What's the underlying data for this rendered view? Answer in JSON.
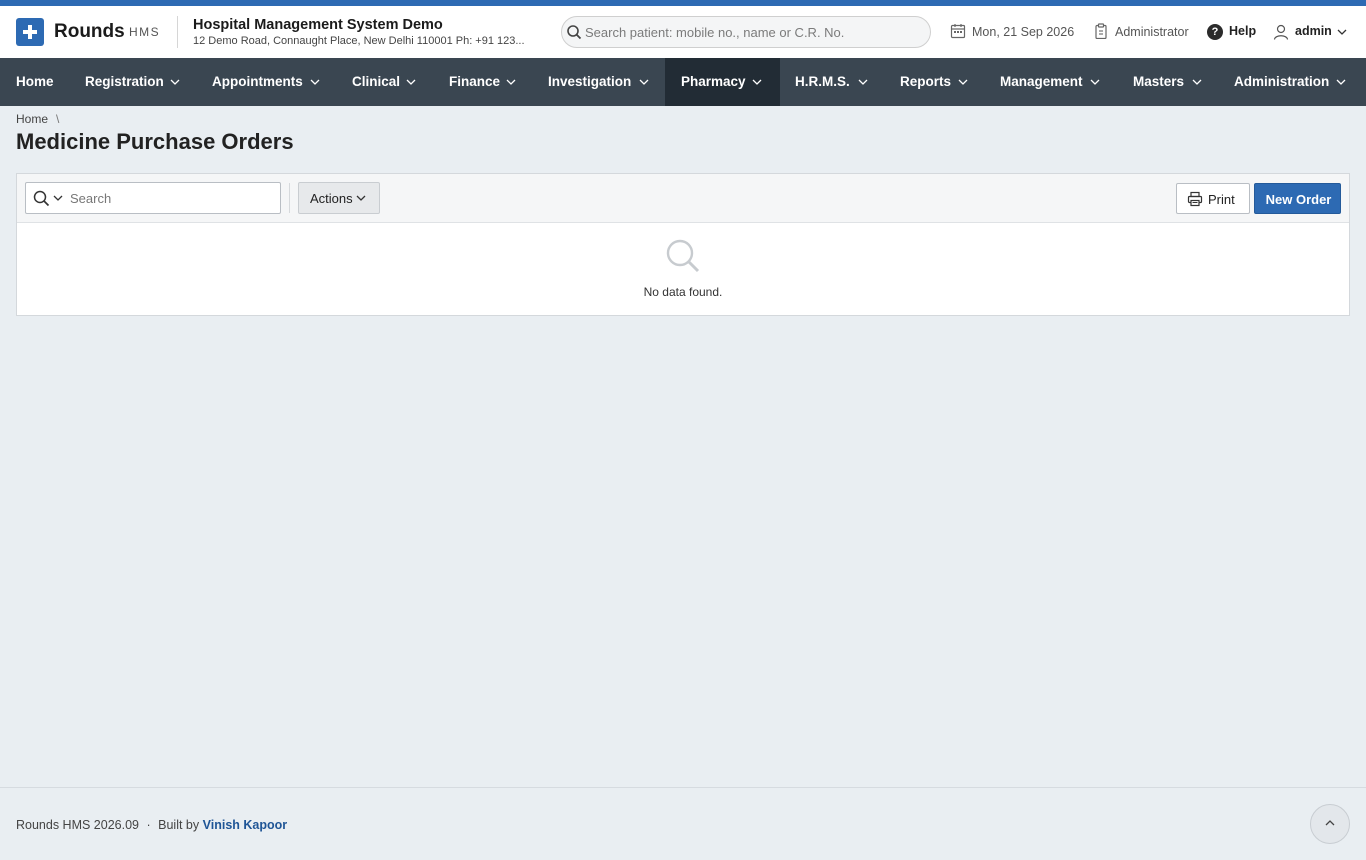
{
  "brand": {
    "name": "Rounds",
    "suffix": "HMS"
  },
  "hospital": {
    "name": "Hospital Management System Demo",
    "address": "12 Demo Road, Connaught Place, New Delhi 110001 Ph: +91 123..."
  },
  "search": {
    "placeholder": "Search patient: mobile no., name or C.R. No."
  },
  "header": {
    "date": "Mon, 21 Sep 2026",
    "role": "Administrator",
    "help": "Help",
    "user": "admin"
  },
  "nav": {
    "items": [
      {
        "label": "Home"
      },
      {
        "label": "Registration"
      },
      {
        "label": "Appointments"
      },
      {
        "label": "Clinical"
      },
      {
        "label": "Finance"
      },
      {
        "label": "Investigation"
      },
      {
        "label": "Pharmacy"
      },
      {
        "label": "H.R.M.S."
      },
      {
        "label": "Reports"
      },
      {
        "label": "Management"
      },
      {
        "label": "Masters"
      },
      {
        "label": "Administration"
      }
    ],
    "active": "Pharmacy"
  },
  "breadcrumb": {
    "home": "Home",
    "separator": "\\"
  },
  "page": {
    "title": "Medicine Purchase Orders"
  },
  "toolbar": {
    "search_placeholder": "Search",
    "actions_label": "Actions",
    "print_label": "Print",
    "new_label": "New Order"
  },
  "empty": {
    "message": "No data found."
  },
  "footer": {
    "version": "Rounds HMS 2026.09",
    "separator": "·",
    "built_by": "Built by",
    "author": "Vinish Kapoor"
  },
  "colors": {
    "accent": "#2d6ab3",
    "nav_bg": "#3a4651",
    "nav_active": "#222c35",
    "page_bg": "#e9eef2"
  }
}
